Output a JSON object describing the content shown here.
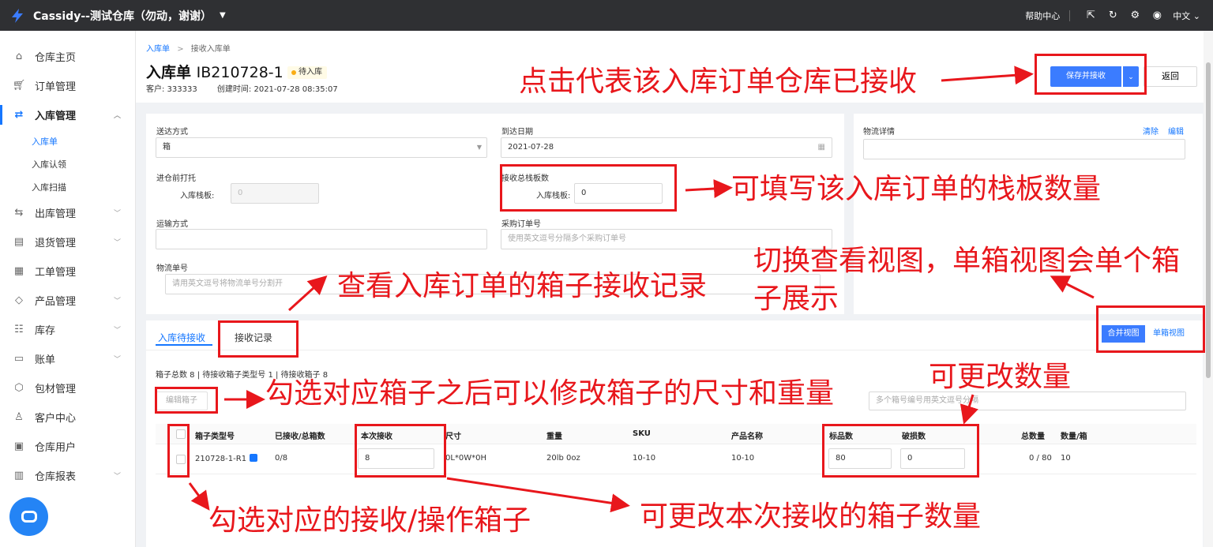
{
  "topbar": {
    "title": "Cassidy--测试仓库（勿动，谢谢）",
    "help": "帮助中心",
    "lang": "中文"
  },
  "sidebar": {
    "items": [
      {
        "label": "仓库主页",
        "icon": "home-icon"
      },
      {
        "label": "订单管理",
        "icon": "cart-icon"
      },
      {
        "label": "入库管理",
        "icon": "inbound-icon"
      },
      {
        "label": "出库管理",
        "icon": "outbound-icon"
      },
      {
        "label": "退货管理",
        "icon": "return-icon"
      },
      {
        "label": "工单管理",
        "icon": "workorder-icon"
      },
      {
        "label": "产品管理",
        "icon": "tag-icon"
      },
      {
        "label": "库存",
        "icon": "inventory-icon"
      },
      {
        "label": "账单",
        "icon": "bill-icon"
      },
      {
        "label": "包材管理",
        "icon": "package-icon"
      },
      {
        "label": "客户中心",
        "icon": "customer-icon"
      },
      {
        "label": "仓库用户",
        "icon": "user-card-icon"
      },
      {
        "label": "仓库报表",
        "icon": "report-icon"
      }
    ],
    "subitems": [
      "入库单",
      "入库认领",
      "入库扫描"
    ]
  },
  "header": {
    "crumb_parent": "入库单",
    "crumb_sep": ">",
    "crumb_current": "接收入库单",
    "title_prefix": "入库单",
    "order_no": "IB210728-1",
    "status": "待入库",
    "customer": "客户: 333333",
    "created": "创建时间: 2021-07-28 08:35:07",
    "save_btn": "保存并接收",
    "back_btn": "返回"
  },
  "form": {
    "delivery_label": "送达方式",
    "delivery_value": "箱",
    "arrival_label": "到达日期",
    "arrival_value": "2021-07-28",
    "pre_pallet_label": "进仓前打托",
    "pre_pallet_inner": "入库栈板:",
    "pre_pallet_value": "0",
    "recv_pallet_label": "接收总栈板数",
    "recv_pallet_inner": "入库栈板:",
    "recv_pallet_value": "0",
    "ship_label": "运输方式",
    "po_label": "采购订单号",
    "po_placeholder": "使用英文逗号分隔多个采购订单号",
    "tracking_label": "物流单号",
    "tracking_placeholder": "请用英文逗号将物流单号分割开"
  },
  "logistics": {
    "label": "物流详情",
    "clear": "清除",
    "edit": "编辑"
  },
  "tabs": {
    "pending": "入库待接收",
    "records": "接收记录",
    "merge_view": "合并视图",
    "single_view": "单箱视图"
  },
  "summary": "箱子总数 8 | 待接收箱子类型号 1 | 待接收箱子 8",
  "edit_box_btn": "编辑箱子",
  "search_placeholder": "多个箱号编号用英文逗号分隔",
  "table": {
    "headers": [
      "箱子类型号",
      "已接收/总箱数",
      "本次接收",
      "尺寸",
      "重量",
      "SKU",
      "产品名称",
      "标品数",
      "破损数",
      "总数量",
      "数量/箱"
    ],
    "row": {
      "box_type": "210728-1-R1",
      "received": "0/8",
      "this_receive": "8",
      "size": "0L*0W*0H",
      "weight": "20lb 0oz",
      "sku": "10-10",
      "product": "10-10",
      "good_qty": "80",
      "damaged": "0",
      "total": "0 / 80",
      "per_box": "10"
    }
  },
  "annotations": {
    "save": "点击代表该入库订单仓库已接收",
    "pallet": "可填写该入库订单的栈板数量",
    "records": "查看入库订单的箱子接收记录",
    "view1": "切换查看视图，单箱视图会单个箱",
    "view2": "子展示",
    "editbox": "勾选对应箱子之后可以修改箱子的尺寸和重量",
    "qty": "可更改数量",
    "check": "勾选对应的接收/操作箱子",
    "thisrecv": "可更改本次接收的箱子数量"
  },
  "colors": {
    "accent": "#1677ff",
    "primary_btn": "#3b7cff",
    "annotation": "#e8171c",
    "topbar": "#2f3033"
  }
}
